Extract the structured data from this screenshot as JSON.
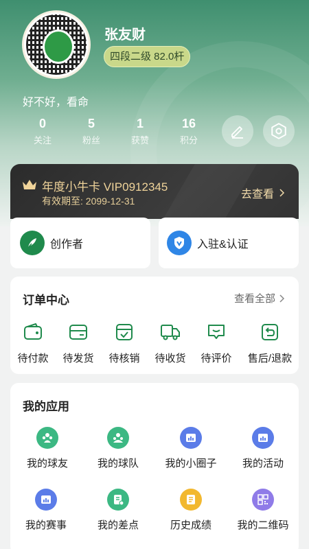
{
  "profile": {
    "name": "张友财",
    "level": "四段二级 82.0杆",
    "bio": "好不好，看命"
  },
  "stats": [
    {
      "value": "0",
      "label": "关注"
    },
    {
      "value": "5",
      "label": "粉丝"
    },
    {
      "value": "1",
      "label": "获赞"
    },
    {
      "value": "16",
      "label": "积分"
    }
  ],
  "vip": {
    "title": "年度小牛卡 VIP0912345",
    "expire": "有效期至: 2099-12-31",
    "link": "去查看"
  },
  "quick_cards": [
    {
      "label": "创作者",
      "icon": "feather-icon"
    },
    {
      "label": "入驻&认证",
      "icon": "verified-shield-icon"
    }
  ],
  "orders": {
    "title": "订单中心",
    "see_all": "查看全部",
    "items": [
      {
        "label": "待付款",
        "icon": "wallet-icon"
      },
      {
        "label": "待发货",
        "icon": "card-icon"
      },
      {
        "label": "待核销",
        "icon": "check-box-icon"
      },
      {
        "label": "待收货",
        "icon": "truck-icon"
      },
      {
        "label": "待评价",
        "icon": "comment-icon"
      },
      {
        "label": "售后/退款",
        "icon": "return-icon"
      }
    ]
  },
  "apps": {
    "title": "我的应用",
    "items": [
      {
        "label": "我的球友",
        "icon": "friends-icon",
        "color": "#3cb883"
      },
      {
        "label": "我的球队",
        "icon": "team-icon",
        "color": "#3cb883"
      },
      {
        "label": "我的小圈子",
        "icon": "circle-group-icon",
        "color": "#5b7ce8"
      },
      {
        "label": "我的活动",
        "icon": "activity-icon",
        "color": "#5b7ce8"
      },
      {
        "label": "我的赛事",
        "icon": "tournament-icon",
        "color": "#5b7ce8"
      },
      {
        "label": "我的差点",
        "icon": "handicap-icon",
        "color": "#3cb883"
      },
      {
        "label": "历史成绩",
        "icon": "history-icon",
        "color": "#f2b82f"
      },
      {
        "label": "我的二维码",
        "icon": "qrcode-icon",
        "color": "#8f7be8"
      }
    ]
  },
  "colors": {
    "header_green": "#3f8f6f",
    "vip_gold": "#f0d49a",
    "accent_green": "#1f8a4c",
    "accent_blue": "#2f86e6"
  }
}
